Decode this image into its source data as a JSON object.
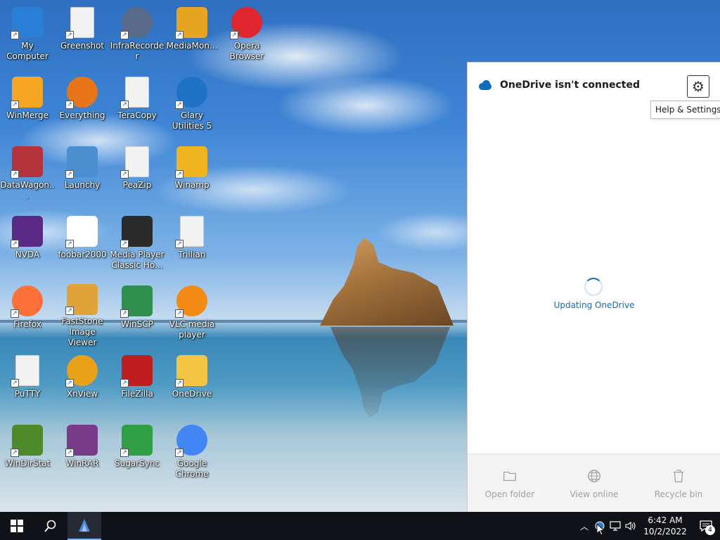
{
  "desktop": {
    "icons": [
      {
        "label": "My Computer",
        "icon": "computer-icon",
        "color": "#2b7fd6"
      },
      {
        "label": "Greenshot",
        "icon": "file-icon",
        "color": "#f2f2f2"
      },
      {
        "label": "InfraRecorder",
        "icon": "disc-icon",
        "color": "#5a6b8a"
      },
      {
        "label": "MediaMon...",
        "icon": "mediamonkey-icon",
        "color": "#e6a421"
      },
      {
        "label": "Opera Browser",
        "icon": "opera-icon",
        "color": "#e0262f"
      },
      {
        "label": "WinMerge",
        "icon": "winmerge-icon",
        "color": "#f5a623"
      },
      {
        "label": "Everything",
        "icon": "magnifier-icon",
        "color": "#e8751a"
      },
      {
        "label": "TeraCopy",
        "icon": "file-icon",
        "color": "#f2f2f2"
      },
      {
        "label": "Glary Utilities 5",
        "icon": "glary-icon",
        "color": "#1e73c8"
      },
      {
        "label": "DataWagon...",
        "icon": "datawagon-icon",
        "color": "#b5343c"
      },
      {
        "label": "Launchy",
        "icon": "rocket-icon",
        "color": "#4a8fd0"
      },
      {
        "label": "PeaZip",
        "icon": "file-icon",
        "color": "#f2f2f2"
      },
      {
        "label": "Winamp",
        "icon": "winamp-icon",
        "color": "#f0b41e"
      },
      {
        "label": "NVDA",
        "icon": "nvda-icon",
        "color": "#5b2a86"
      },
      {
        "label": "foobar2000",
        "icon": "foobar-icon",
        "color": "#ffffff"
      },
      {
        "label": "Media Player Classic Ho...",
        "icon": "mpc-icon",
        "color": "#2a2a2a"
      },
      {
        "label": "Trillian",
        "icon": "file-icon",
        "color": "#f2f2f2"
      },
      {
        "label": "Firefox",
        "icon": "firefox-icon",
        "color": "#ff7139"
      },
      {
        "label": "FastStone Image Viewer",
        "icon": "faststone-icon",
        "color": "#e2a23a"
      },
      {
        "label": "WinSCP",
        "icon": "winscp-icon",
        "color": "#2f8f4e"
      },
      {
        "label": "VLC media player",
        "icon": "vlc-icon",
        "color": "#f28a13"
      },
      {
        "label": "PuTTY",
        "icon": "file-icon",
        "color": "#f2f2f2"
      },
      {
        "label": "XnView",
        "icon": "xnview-icon",
        "color": "#e8a21a"
      },
      {
        "label": "FileZilla",
        "icon": "filezilla-icon",
        "color": "#bf1e1e"
      },
      {
        "label": "OneDrive",
        "icon": "onedrive-folder-icon",
        "color": "#f4c542"
      },
      {
        "label": "WinDirStat",
        "icon": "tree-icon",
        "color": "#4c8a2a"
      },
      {
        "label": "WinRAR",
        "icon": "winrar-icon",
        "color": "#7a3a8a"
      },
      {
        "label": "SugarSync",
        "icon": "hummingbird-icon",
        "color": "#2f9e44"
      },
      {
        "label": "Google Chrome",
        "icon": "chrome-icon",
        "color": "#4285f4"
      }
    ]
  },
  "onedrive": {
    "title": "OneDrive isn't connected",
    "settings_tooltip": "Help & Settings",
    "status": "Updating OneDrive",
    "footer": {
      "open_folder": "Open folder",
      "view_online": "View online",
      "recycle_bin": "Recycle bin"
    },
    "accent": "#0f6cbd"
  },
  "taskbar": {
    "time": "6:42 AM",
    "date": "10/2/2022",
    "notification_count": "4"
  }
}
